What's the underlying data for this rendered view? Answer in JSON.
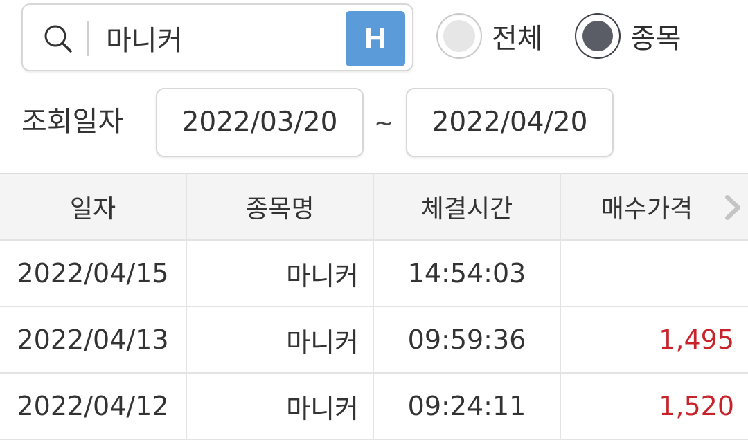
{
  "search": {
    "value": "마니커",
    "h_button": "H"
  },
  "radios": [
    {
      "label": "전체",
      "selected": false
    },
    {
      "label": "종목",
      "selected": true
    }
  ],
  "date_range": {
    "label": "조회일자",
    "start": "2022/03/20",
    "separator": "~",
    "end": "2022/04/20"
  },
  "table": {
    "headers": [
      "일자",
      "종목명",
      "체결시간",
      "매수가격"
    ],
    "rows": [
      {
        "date": "2022/04/15",
        "name": "마니커",
        "time": "14:54:03",
        "price": ""
      },
      {
        "date": "2022/04/13",
        "name": "마니커",
        "time": "09:59:36",
        "price": "1,495"
      },
      {
        "date": "2022/04/12",
        "name": "마니커",
        "time": "09:24:11",
        "price": "1,520"
      }
    ]
  },
  "colors": {
    "accent_blue": "#5b9bd9",
    "price_red": "#c8232b",
    "header_bg": "#f4f4f4"
  },
  "icons": [
    "search-icon",
    "chevron-right-icon"
  ]
}
